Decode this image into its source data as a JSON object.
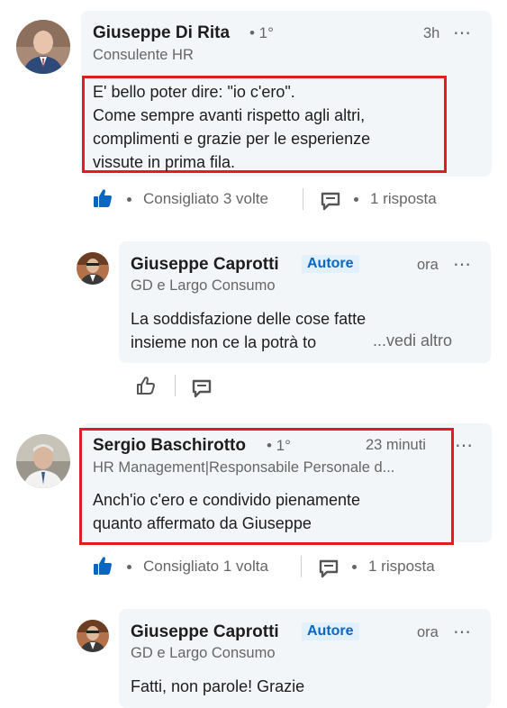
{
  "comments": [
    {
      "author": "Giuseppe Di Rita",
      "degree": "• 1°",
      "headline": "Consulente HR",
      "time": "3h",
      "text_lines": [
        "E' bello poter dire: \"io c'ero\".",
        "Come sempre avanti rispetto agli altri,",
        "complimenti e grazie per le esperienze",
        "vissute in prima fila."
      ],
      "likes": "Consigliato 3 volte",
      "replies": "1 risposta"
    },
    {
      "author": "Giuseppe Caprotti",
      "badge": "Autore",
      "headline": "GD e Largo Consumo",
      "time": "ora",
      "text_lines": [
        "La soddisfazione delle cose fatte",
        "insieme non ce la potrà to"
      ],
      "see_more": "...vedi altro"
    },
    {
      "author": "Sergio Baschirotto",
      "degree": "• 1°",
      "headline": "HR Management|Responsabile Personale d...",
      "time": "23 minuti",
      "text_lines": [
        "Anch'io c'ero e condivido pienamente",
        "quanto affermato da Giuseppe"
      ],
      "likes": "Consigliato 1 volta",
      "replies": "1 risposta"
    },
    {
      "author": "Giuseppe Caprotti",
      "badge": "Autore",
      "headline": "GD e Largo Consumo",
      "time": "ora",
      "text_lines": [
        "Fatti, non parole! Grazie"
      ]
    }
  ],
  "icons": {
    "more": "⋯",
    "like": "thumbs-up-icon",
    "reply": "comment-icon"
  },
  "colors": {
    "accent": "#0a66c2",
    "highlight": "#e31b23",
    "bubble": "#f3f6f8"
  }
}
